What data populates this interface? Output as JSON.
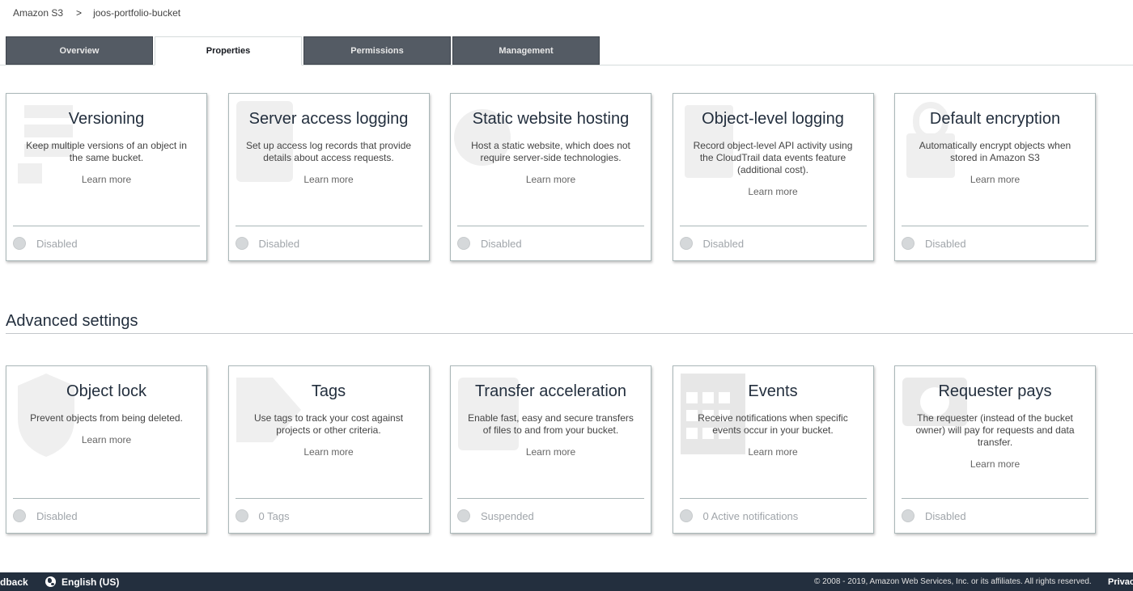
{
  "breadcrumb": {
    "root": "Amazon S3",
    "separator": ">",
    "current": "joos-portfolio-bucket"
  },
  "tabs": [
    {
      "label": "Overview",
      "active": false
    },
    {
      "label": "Properties",
      "active": true
    },
    {
      "label": "Permissions",
      "active": false
    },
    {
      "label": "Management",
      "active": false
    }
  ],
  "cards": [
    {
      "title": "Versioning",
      "desc": "Keep multiple versions of an object in the same bucket.",
      "learn": "Learn more",
      "status": "Disabled",
      "icon": "versioning-icon"
    },
    {
      "title": "Server access logging",
      "desc": "Set up access log records that provide details about access requests.",
      "learn": "Learn more",
      "status": "Disabled",
      "icon": "logging-icon"
    },
    {
      "title": "Static website hosting",
      "desc": "Host a static website, which does not require server-side technologies.",
      "learn": "Learn more",
      "status": "Disabled",
      "icon": "website-icon"
    },
    {
      "title": "Object-level logging",
      "desc": "Record object-level API activity using the CloudTrail data events feature (additional cost).",
      "learn": "Learn more",
      "status": "Disabled",
      "icon": "object-logging-icon"
    },
    {
      "title": "Default encryption",
      "desc": "Automatically encrypt objects when stored in Amazon S3",
      "learn": "Learn more",
      "status": "Disabled",
      "icon": "encryption-icon"
    }
  ],
  "advanced": {
    "title": "Advanced settings",
    "cards": [
      {
        "title": "Object lock",
        "desc": "Prevent objects from being deleted.",
        "learn": "Learn more",
        "status": "Disabled",
        "icon": "lock-icon"
      },
      {
        "title": "Tags",
        "desc": "Use tags to track your cost against projects or other criteria.",
        "learn": "Learn more",
        "status": "0 Tags",
        "icon": "tag-icon"
      },
      {
        "title": "Transfer acceleration",
        "desc": "Enable fast, easy and secure transfers of files to and from your bucket.",
        "learn": "Learn more",
        "status": "Suspended",
        "icon": "acceleration-icon"
      },
      {
        "title": "Events",
        "desc": "Receive notifications when specific events occur in your bucket.",
        "learn": "Learn more",
        "status": "0 Active notifications",
        "icon": "calendar-icon"
      },
      {
        "title": "Requester pays",
        "desc": "The requester (instead of the bucket owner) will pay for requests and data transfer.",
        "learn": "Learn more",
        "status": "Disabled",
        "icon": "payment-icon"
      }
    ]
  },
  "footer": {
    "feedback": "dback",
    "language": "English (US)",
    "copyright": "© 2008 - 2019, Amazon Web Services, Inc. or its affiliates. All rights reserved.",
    "privacy": "Privacy"
  },
  "colors": {
    "tab_inactive": "#545b64",
    "footer_bg": "#232f3e",
    "status_dot": "#d5d8da"
  }
}
